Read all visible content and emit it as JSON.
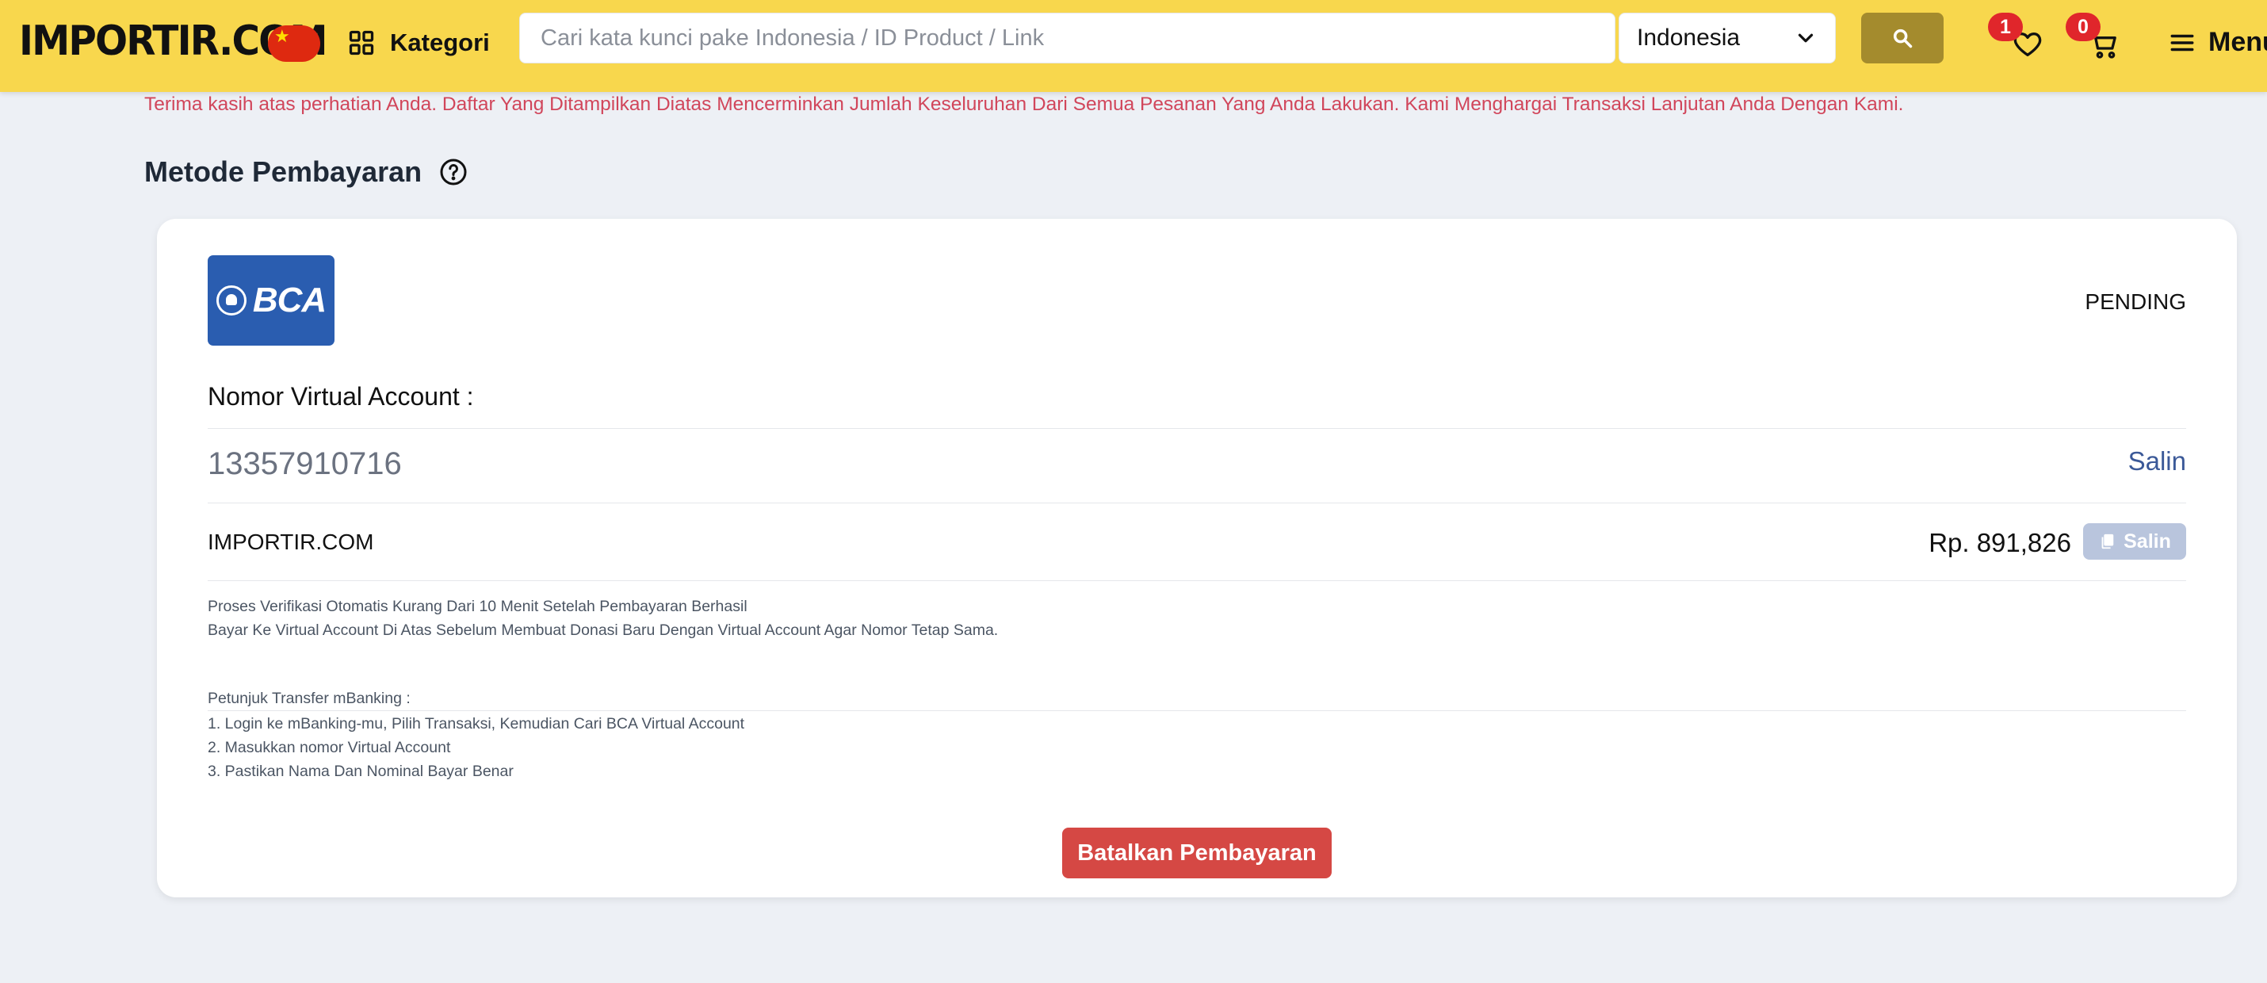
{
  "header": {
    "logo": "IMPORTIR.COM",
    "flag": "china-flag",
    "category_label": "Kategori",
    "search": {
      "placeholder": "Cari kata kunci pake Indonesia / ID Product / Link",
      "value": ""
    },
    "country_select": {
      "selected": "Indonesia"
    },
    "wishlist_count": "1",
    "cart_count": "0",
    "menu_label": "Menu"
  },
  "notice": "Terima kasih atas perhatian Anda. Daftar Yang Ditampilkan Diatas Mencerminkan Jumlah Keseluruhan Dari Semua Pesanan Yang Anda Lakukan. Kami Menghargai Transaksi Lanjutan Anda Dengan Kami.",
  "section": {
    "title": "Metode Pembayaran"
  },
  "payment": {
    "bank_logo": "BCA",
    "status": "PENDING",
    "va_label": "Nomor Virtual Account :",
    "va_number": "13357910716",
    "copy_label": "Salin",
    "merchant": "IMPORTIR.COM",
    "amount": "Rp. 891,826",
    "copy_amount_label": "Salin",
    "info": [
      "Proses Verifikasi Otomatis Kurang Dari 10 Menit Setelah Pembayaran Berhasil",
      "Bayar Ke Virtual Account Di Atas Sebelum Membuat Donasi Baru Dengan Virtual Account Agar Nomor Tetap Sama."
    ],
    "instructions_title": "Petunjuk Transfer mBanking :",
    "instructions": [
      "1. Login ke mBanking-mu, Pilih Transaksi, Kemudian Cari BCA Virtual Account",
      "2. Masukkan nomor Virtual Account",
      "3. Pastikan Nama Dan Nominal Bayar Benar"
    ],
    "cancel_label": "Batalkan Pembayaran"
  },
  "colors": {
    "header_bg": "#f8d74d",
    "search_button": "#a48b2d",
    "badge": "#e0262b",
    "notice_text": "#d1465b",
    "bca_blue": "#2a5db0",
    "cancel_button": "#d54844",
    "copy_link": "#3b5998"
  }
}
